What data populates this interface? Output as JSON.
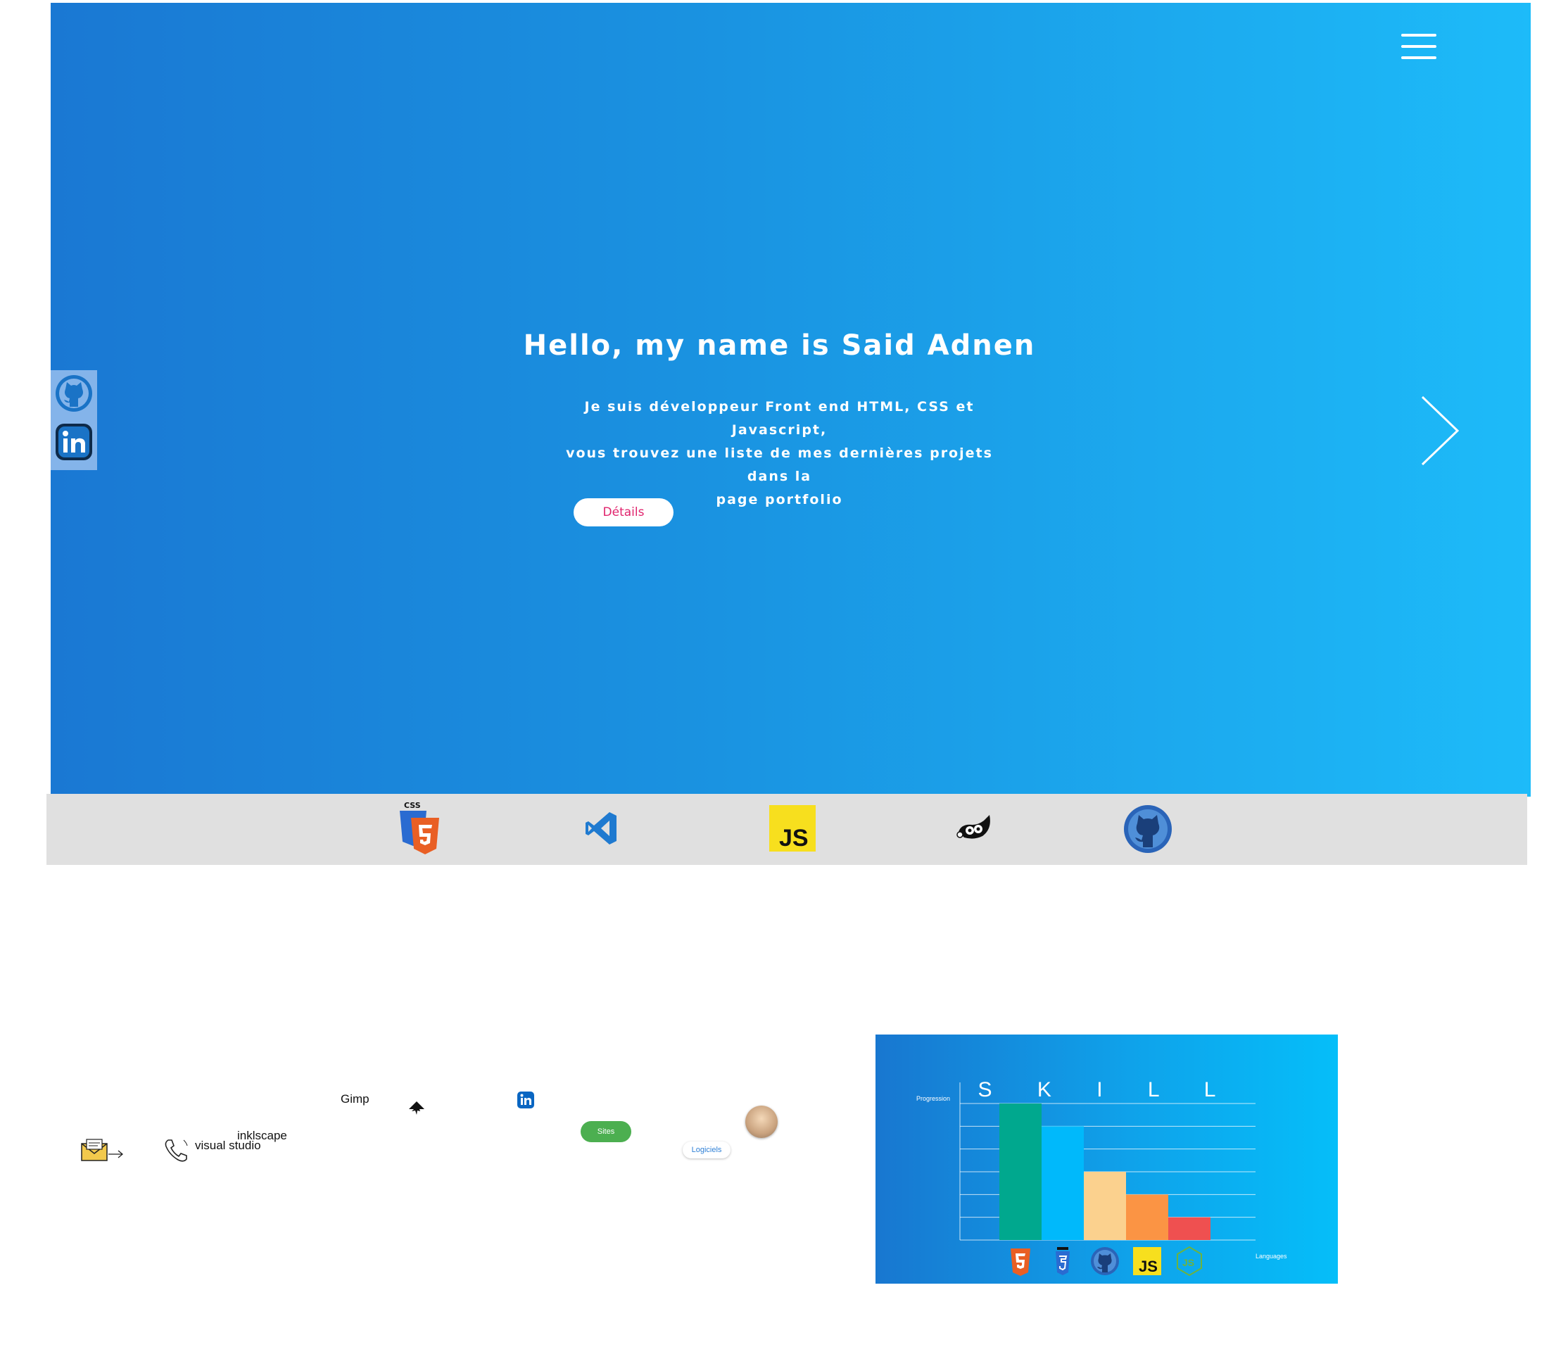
{
  "hero": {
    "title": "Hello, my name is Said Adnen",
    "description_lines": [
      "Je suis développeur Front end HTML, CSS et Javascript,",
      "vous trouvez une liste de mes dernières projets dans la",
      "page portfolio"
    ],
    "details_button": "Détails",
    "colors": {
      "gradient_start": "#1a78d3",
      "gradient_end": "#1dbbf9",
      "button_text": "#e0246d"
    }
  },
  "menu": {
    "icon": "hamburger-menu-icon"
  },
  "social": [
    {
      "name": "github",
      "icon": "github-icon"
    },
    {
      "name": "linkedin",
      "icon": "linkedin-icon"
    }
  ],
  "tech_strip": [
    {
      "name": "css-html",
      "icon": "css3-html5-icon"
    },
    {
      "name": "vscode",
      "icon": "vscode-icon"
    },
    {
      "name": "javascript",
      "icon": "javascript-icon",
      "label": "JS"
    },
    {
      "name": "gimp",
      "icon": "gimp-icon"
    },
    {
      "name": "github",
      "icon": "github-icon"
    }
  ],
  "contact_row": {
    "gimp_label": "Gimp",
    "inkscape_label": "inklscape",
    "visual_studio_label": "visual studio",
    "sites_button": "Sites",
    "logiciels_button": "Logiciels",
    "icons": [
      "mail-icon",
      "arrow-right-icon",
      "phone-icon",
      "inkscape-icon",
      "linkedin-icon",
      "avatar"
    ]
  },
  "chart_data": {
    "type": "bar",
    "title": "S K I L L",
    "ylabel": "Progression",
    "xlabel": "Languages",
    "categories": [
      "HTML5",
      "CSS3",
      "GitHub",
      "JS",
      "Node.js"
    ],
    "values": [
      6,
      5,
      3,
      2,
      1
    ],
    "ylim": [
      0,
      6
    ],
    "grid": true,
    "colors": [
      "#00a88e",
      "#00b9fb",
      "#fbd18e",
      "#fb9444",
      "#ef5050"
    ],
    "tick_icons": [
      "html5-icon",
      "css3-icon",
      "github-icon",
      "javascript-icon",
      "nodejs-icon"
    ]
  }
}
